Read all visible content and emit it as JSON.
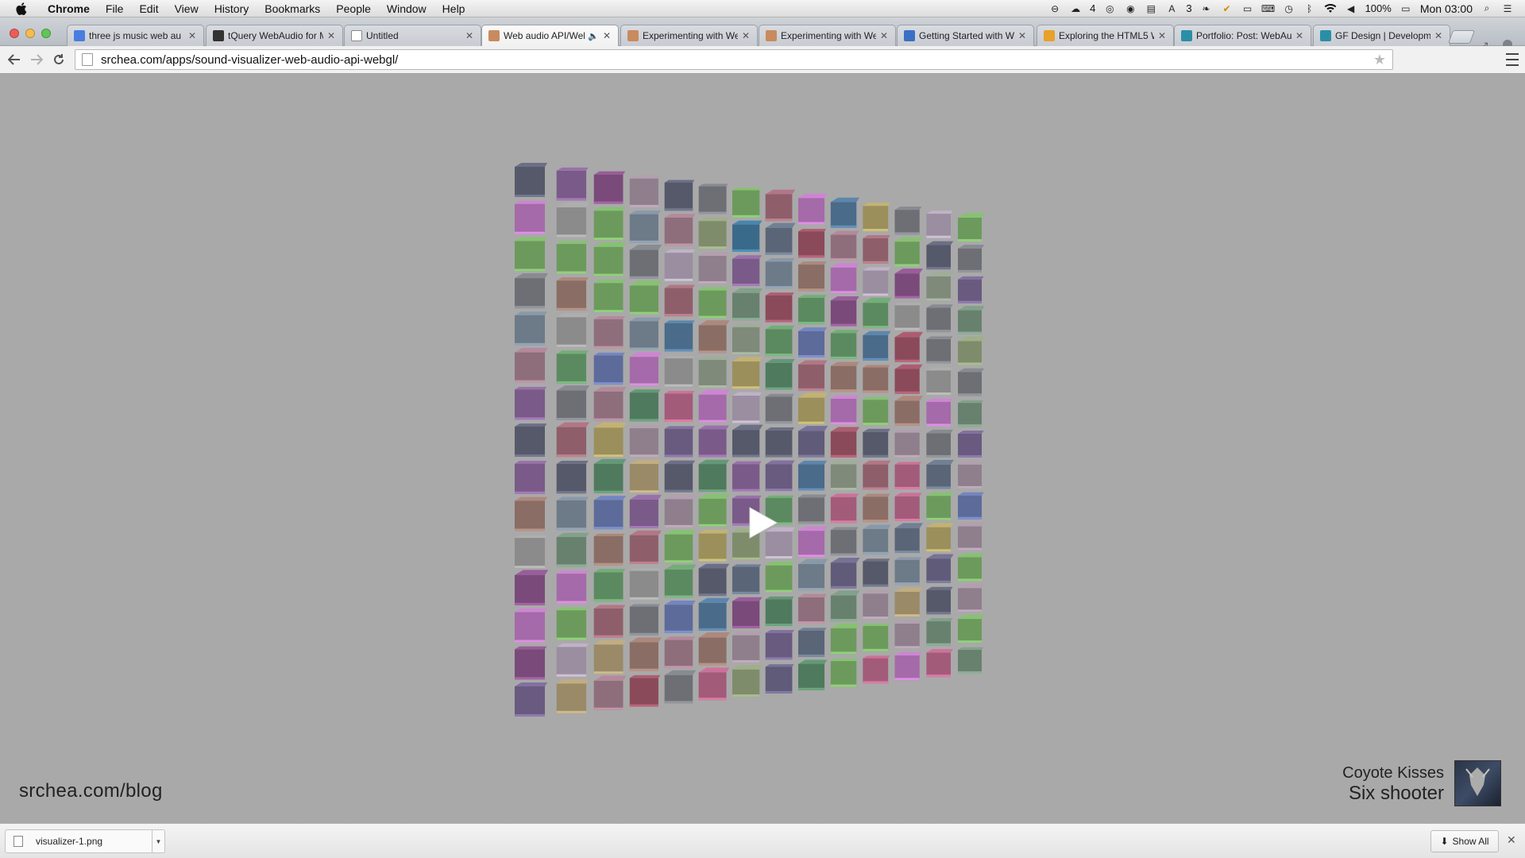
{
  "menubar": {
    "apple_icon": "apple-icon",
    "app_name": "Chrome",
    "items": [
      "File",
      "Edit",
      "View",
      "History",
      "Bookmarks",
      "People",
      "Window",
      "Help"
    ],
    "status": {
      "badge_count_1": "4",
      "badge_count_2": "3",
      "battery": "100%",
      "clock": "Mon 03:00"
    }
  },
  "tabs": [
    {
      "title": "three js music web au",
      "favicon": "google-icon",
      "color": "#4a7de0",
      "active": false
    },
    {
      "title": "tQuery WebAudio for M",
      "favicon": "tquery-icon",
      "color": "#333333",
      "active": false
    },
    {
      "title": "Untitled",
      "favicon": "page-icon",
      "color": "#ffffff",
      "active": false
    },
    {
      "title": "Web audio API/Web",
      "favicon": "avatar-icon",
      "color": "#c98a5e",
      "active": true,
      "audio": true
    },
    {
      "title": "Experimenting with We",
      "favicon": "avatar-icon",
      "color": "#c98a5e",
      "active": false
    },
    {
      "title": "Experimenting with We",
      "favicon": "avatar-icon",
      "color": "#c98a5e",
      "active": false
    },
    {
      "title": "Getting Started with W",
      "favicon": "html5-icon",
      "color": "#3b6fc4",
      "active": false
    },
    {
      "title": "Exploring the HTML5 W",
      "favicon": "exploring-icon",
      "color": "#e8a12a",
      "active": false
    },
    {
      "title": "Portfolio: Post: WebAu",
      "favicon": "portfolio-icon",
      "color": "#2a8fa6",
      "active": false
    },
    {
      "title": "GF Design | Developme",
      "favicon": "gf-icon",
      "color": "#2a8fa6",
      "active": false
    }
  ],
  "toolbar": {
    "url": "srchea.com/apps/sound-visualizer-web-audio-api-webgl/"
  },
  "page": {
    "blog_link": "srchea.com/blog",
    "artist": "Coyote Kisses",
    "song": "Six shooter",
    "play_icon": "play-icon",
    "colors": {
      "background": "#a9a9a9",
      "cube_palette": [
        "#8f7f8c",
        "#9a8ea0",
        "#6d6f75",
        "#a56aa9",
        "#8b8b8b",
        "#7f8c6b",
        "#8e5f6b",
        "#8f6e7c",
        "#5a6677",
        "#5c8a60",
        "#5f5b78",
        "#695a80",
        "#6c9a5c",
        "#56596a",
        "#7f8a7a",
        "#8a6d64",
        "#6d7a88",
        "#a35b7a",
        "#7a5a88",
        "#9a8a68",
        "#5d6b9a",
        "#68816e",
        "#4a6b8a",
        "#8a4a5a",
        "#9b8f5b",
        "#4f7a5e",
        "#7a4a7a",
        "#3a6a8a"
      ]
    }
  },
  "downloads": {
    "file_name": "visualizer-1.png",
    "show_all": "Show All"
  }
}
